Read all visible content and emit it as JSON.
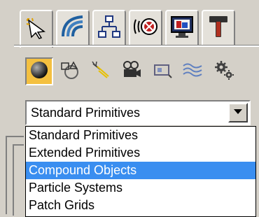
{
  "command_panel": {
    "tabs": [
      {
        "id": "create",
        "icon": "create-arrow-icon",
        "active": true
      },
      {
        "id": "modify",
        "icon": "modify-rainbow-icon",
        "active": false
      },
      {
        "id": "hierarchy",
        "icon": "hierarchy-icon",
        "active": false
      },
      {
        "id": "motion",
        "icon": "motion-circle-icon",
        "active": false
      },
      {
        "id": "display",
        "icon": "display-monitor-icon",
        "active": false
      },
      {
        "id": "utilities",
        "icon": "hammer-icon",
        "active": false
      }
    ],
    "object_types": [
      {
        "id": "geometry",
        "icon": "sphere-icon",
        "active": true
      },
      {
        "id": "shapes",
        "icon": "shapes-icon",
        "active": false
      },
      {
        "id": "lights",
        "icon": "lights-icon",
        "active": false
      },
      {
        "id": "cameras",
        "icon": "camera-icon",
        "active": false
      },
      {
        "id": "helpers",
        "icon": "helpers-icon",
        "active": false
      },
      {
        "id": "spacewarps",
        "icon": "spacewarp-icon",
        "active": false
      },
      {
        "id": "systems",
        "icon": "gears-icon",
        "active": false
      }
    ],
    "dropdown": {
      "selected": "Standard Primitives",
      "options": [
        "Standard Primitives",
        "Extended Primitives",
        "Compound Objects",
        "Particle Systems",
        "Patch Grids"
      ],
      "highlighted_index": 2
    },
    "colors": {
      "highlight": "#3a8ef0",
      "active_button": "#f4c040",
      "panel_bg": "#d4d0c8"
    }
  }
}
